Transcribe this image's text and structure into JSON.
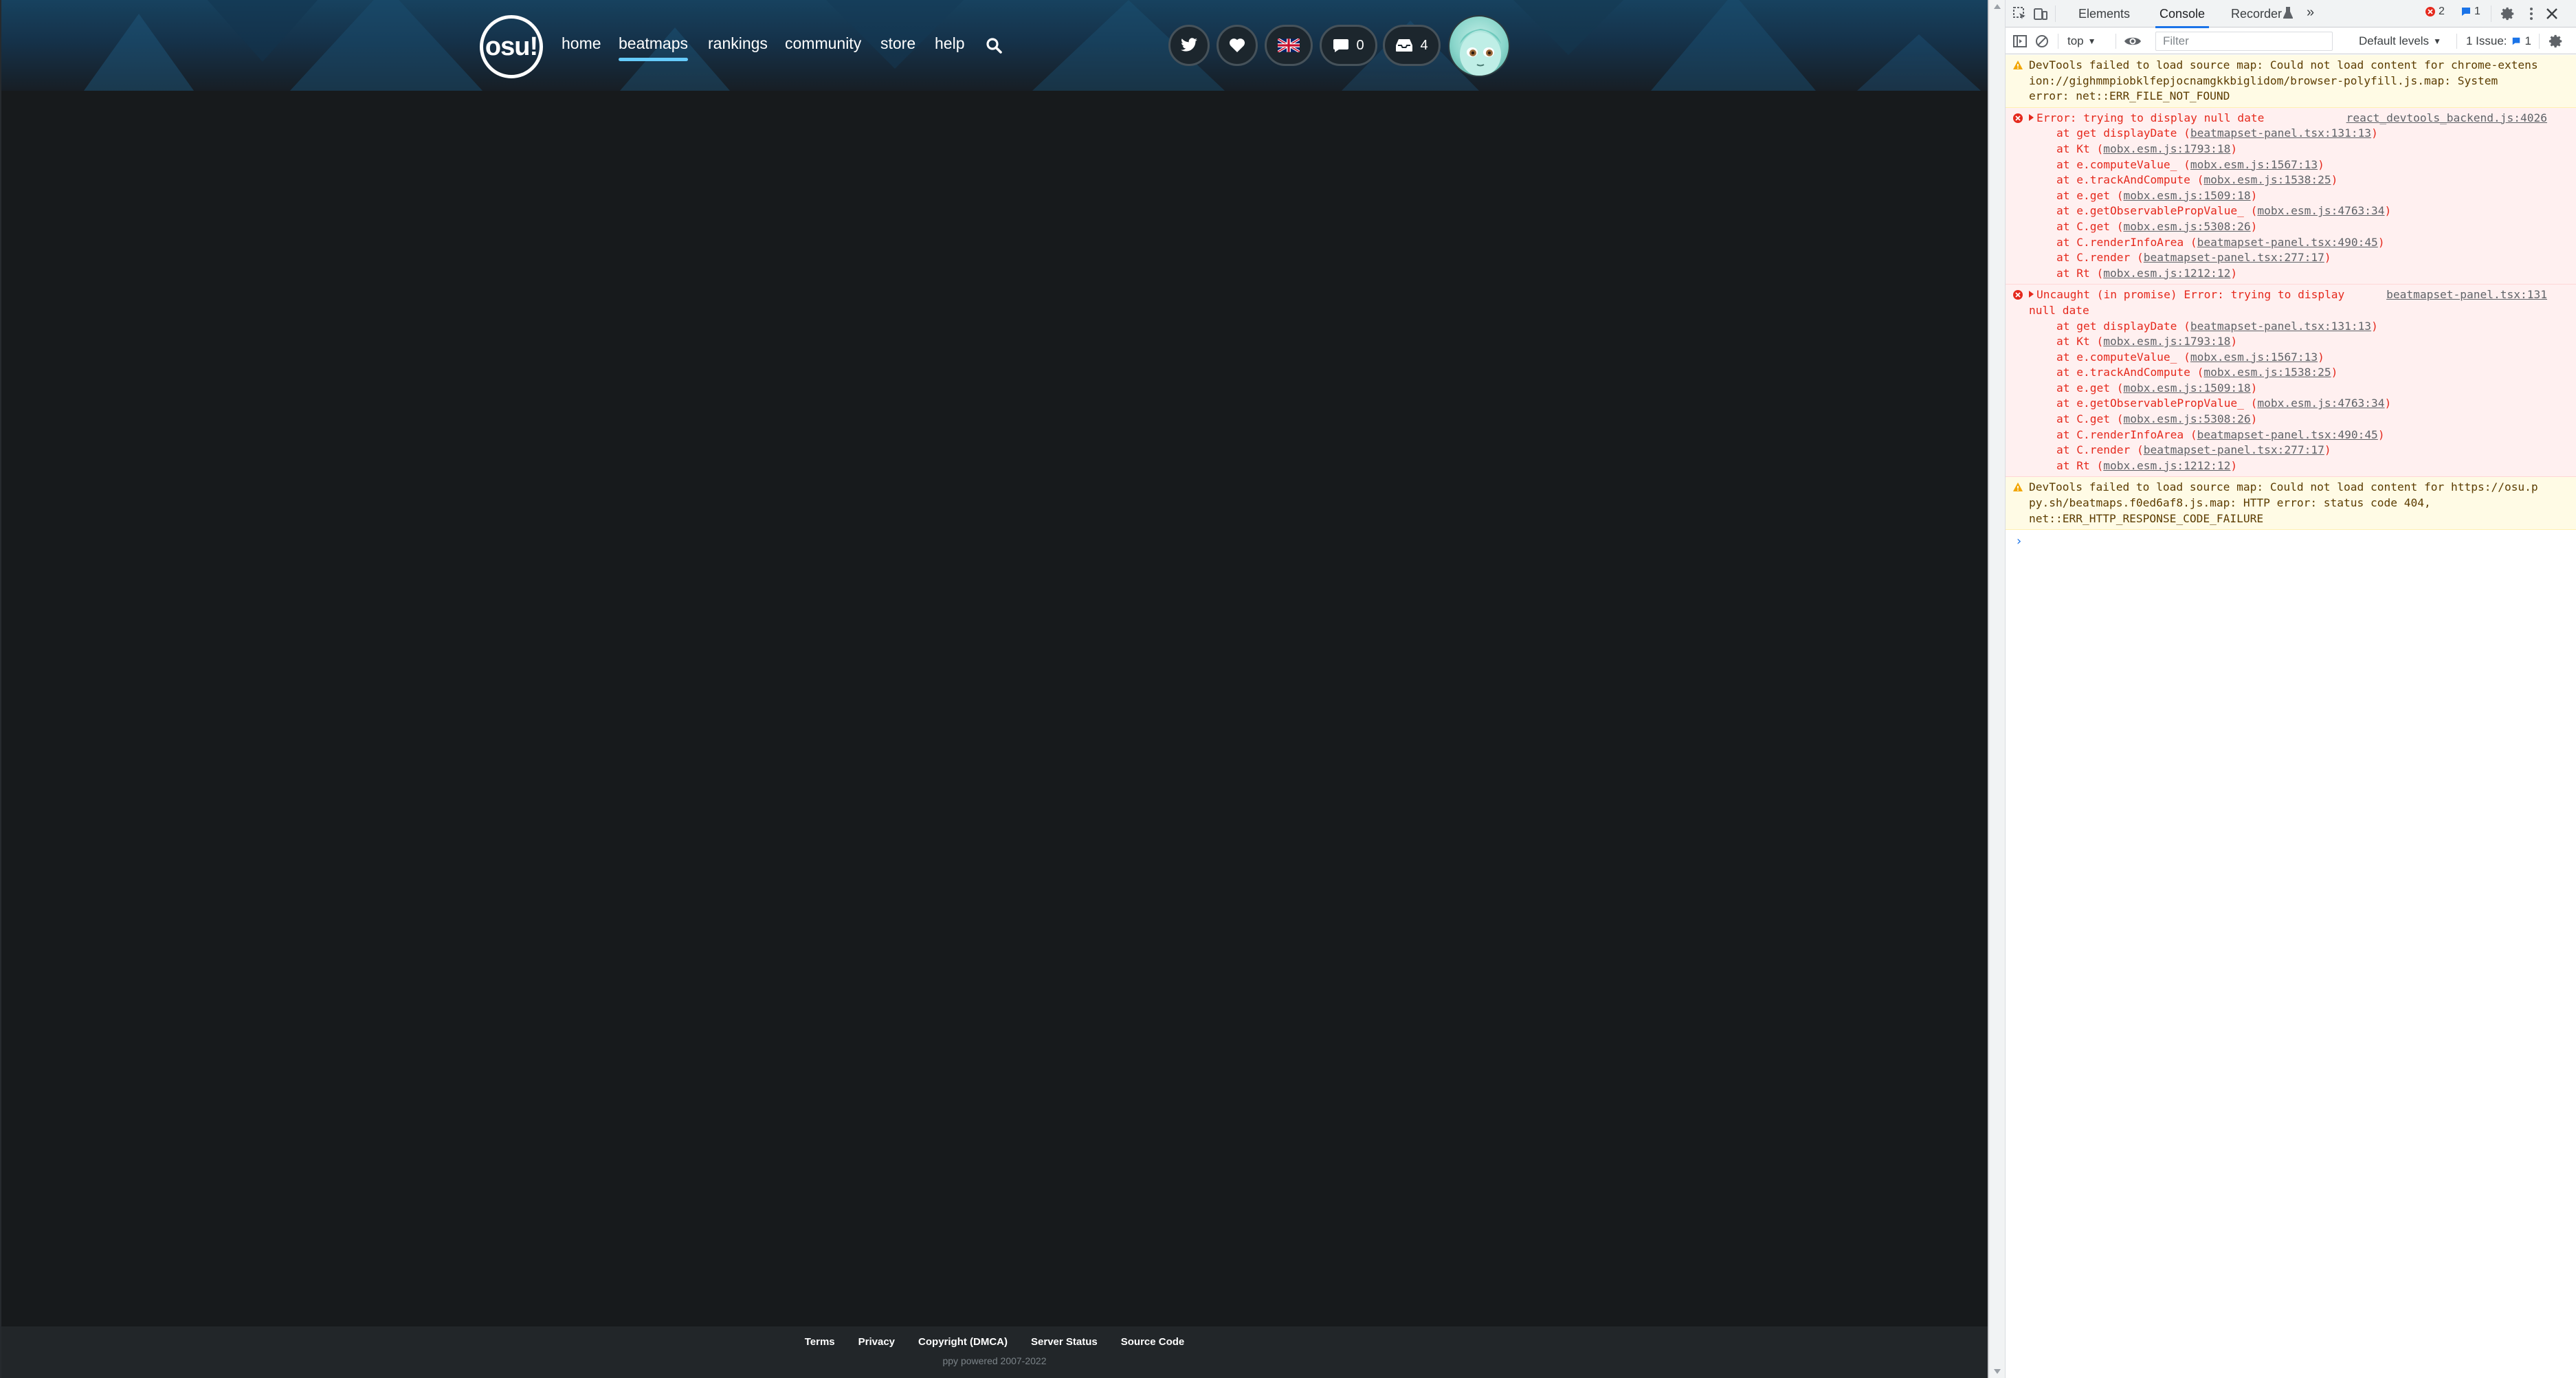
{
  "nav": {
    "logo": "osu!",
    "links": [
      {
        "label": "home",
        "x": 0
      },
      {
        "label": "beatmaps",
        "active": true
      },
      {
        "label": "rankings"
      },
      {
        "label": "community"
      },
      {
        "label": "store"
      },
      {
        "label": "help"
      }
    ],
    "chat_count": "0",
    "notif_count": "4"
  },
  "footer": {
    "links": [
      "Terms",
      "Privacy",
      "Copyright (DMCA)",
      "Server Status",
      "Source Code"
    ],
    "copyright": "ppy powered 2007-2022"
  },
  "devtools": {
    "tabs": [
      "Elements",
      "Console",
      "Recorder",
      "»"
    ],
    "active_tab": "Console",
    "error_count": "2",
    "info_count": "1",
    "toolbar": {
      "context": "top",
      "filter_placeholder": "Filter",
      "levels": "Default levels",
      "issues": "1 Issue:",
      "issues_count": "1"
    },
    "messages": [
      {
        "type": "warn",
        "lines": [
          "DevTools failed to load source map: Could not load content for chrome-extens",
          "ion://gighmmpiobklfepjocnamgkkbiglidom/browser-polyfill.js.map: System",
          "error: net::ERR_FILE_NOT_FOUND"
        ]
      },
      {
        "type": "err",
        "head": "Error: trying to display null date",
        "src": "react_devtools_backend.js:4026",
        "stack": [
          [
            "at get displayDate (",
            "beatmapset-panel.tsx:131:13",
            ")"
          ],
          [
            "at Kt (",
            "mobx.esm.js:1793:18",
            ")"
          ],
          [
            "at e.computeValue_ (",
            "mobx.esm.js:1567:13",
            ")"
          ],
          [
            "at e.trackAndCompute (",
            "mobx.esm.js:1538:25",
            ")"
          ],
          [
            "at e.get (",
            "mobx.esm.js:1509:18",
            ")"
          ],
          [
            "at e.getObservablePropValue_ (",
            "mobx.esm.js:4763:34",
            ")"
          ],
          [
            "at C.get (",
            "mobx.esm.js:5308:26",
            ")"
          ],
          [
            "at C.renderInfoArea (",
            "beatmapset-panel.tsx:490:45",
            ")"
          ],
          [
            "at C.render (",
            "beatmapset-panel.tsx:277:17",
            ")"
          ],
          [
            "at Rt (",
            "mobx.esm.js:1212:12",
            ")"
          ]
        ]
      },
      {
        "type": "err",
        "head": "Uncaught (in promise) Error: trying to display",
        "head2": "null date",
        "src": "beatmapset-panel.tsx:131",
        "stack": [
          [
            "at get displayDate (",
            "beatmapset-panel.tsx:131:13",
            ")"
          ],
          [
            "at Kt (",
            "mobx.esm.js:1793:18",
            ")"
          ],
          [
            "at e.computeValue_ (",
            "mobx.esm.js:1567:13",
            ")"
          ],
          [
            "at e.trackAndCompute (",
            "mobx.esm.js:1538:25",
            ")"
          ],
          [
            "at e.get (",
            "mobx.esm.js:1509:18",
            ")"
          ],
          [
            "at e.getObservablePropValue_ (",
            "mobx.esm.js:4763:34",
            ")"
          ],
          [
            "at C.get (",
            "mobx.esm.js:5308:26",
            ")"
          ],
          [
            "at C.renderInfoArea (",
            "beatmapset-panel.tsx:490:45",
            ")"
          ],
          [
            "at C.render (",
            "beatmapset-panel.tsx:277:17",
            ")"
          ],
          [
            "at Rt (",
            "mobx.esm.js:1212:12",
            ")"
          ]
        ]
      },
      {
        "type": "warn",
        "lines": [
          "DevTools failed to load source map: Could not load content for https://osu.p",
          "py.sh/beatmaps.f0ed6af8.js.map: HTTP error: status code 404,",
          "net::ERR_HTTP_RESPONSE_CODE_FAILURE"
        ]
      }
    ],
    "prompt": "›"
  },
  "colors": {
    "accent": "#66ccff",
    "devtools_blue": "#1a73e8",
    "error_red": "#e5291d",
    "warn_bg": "#fffbe5"
  }
}
